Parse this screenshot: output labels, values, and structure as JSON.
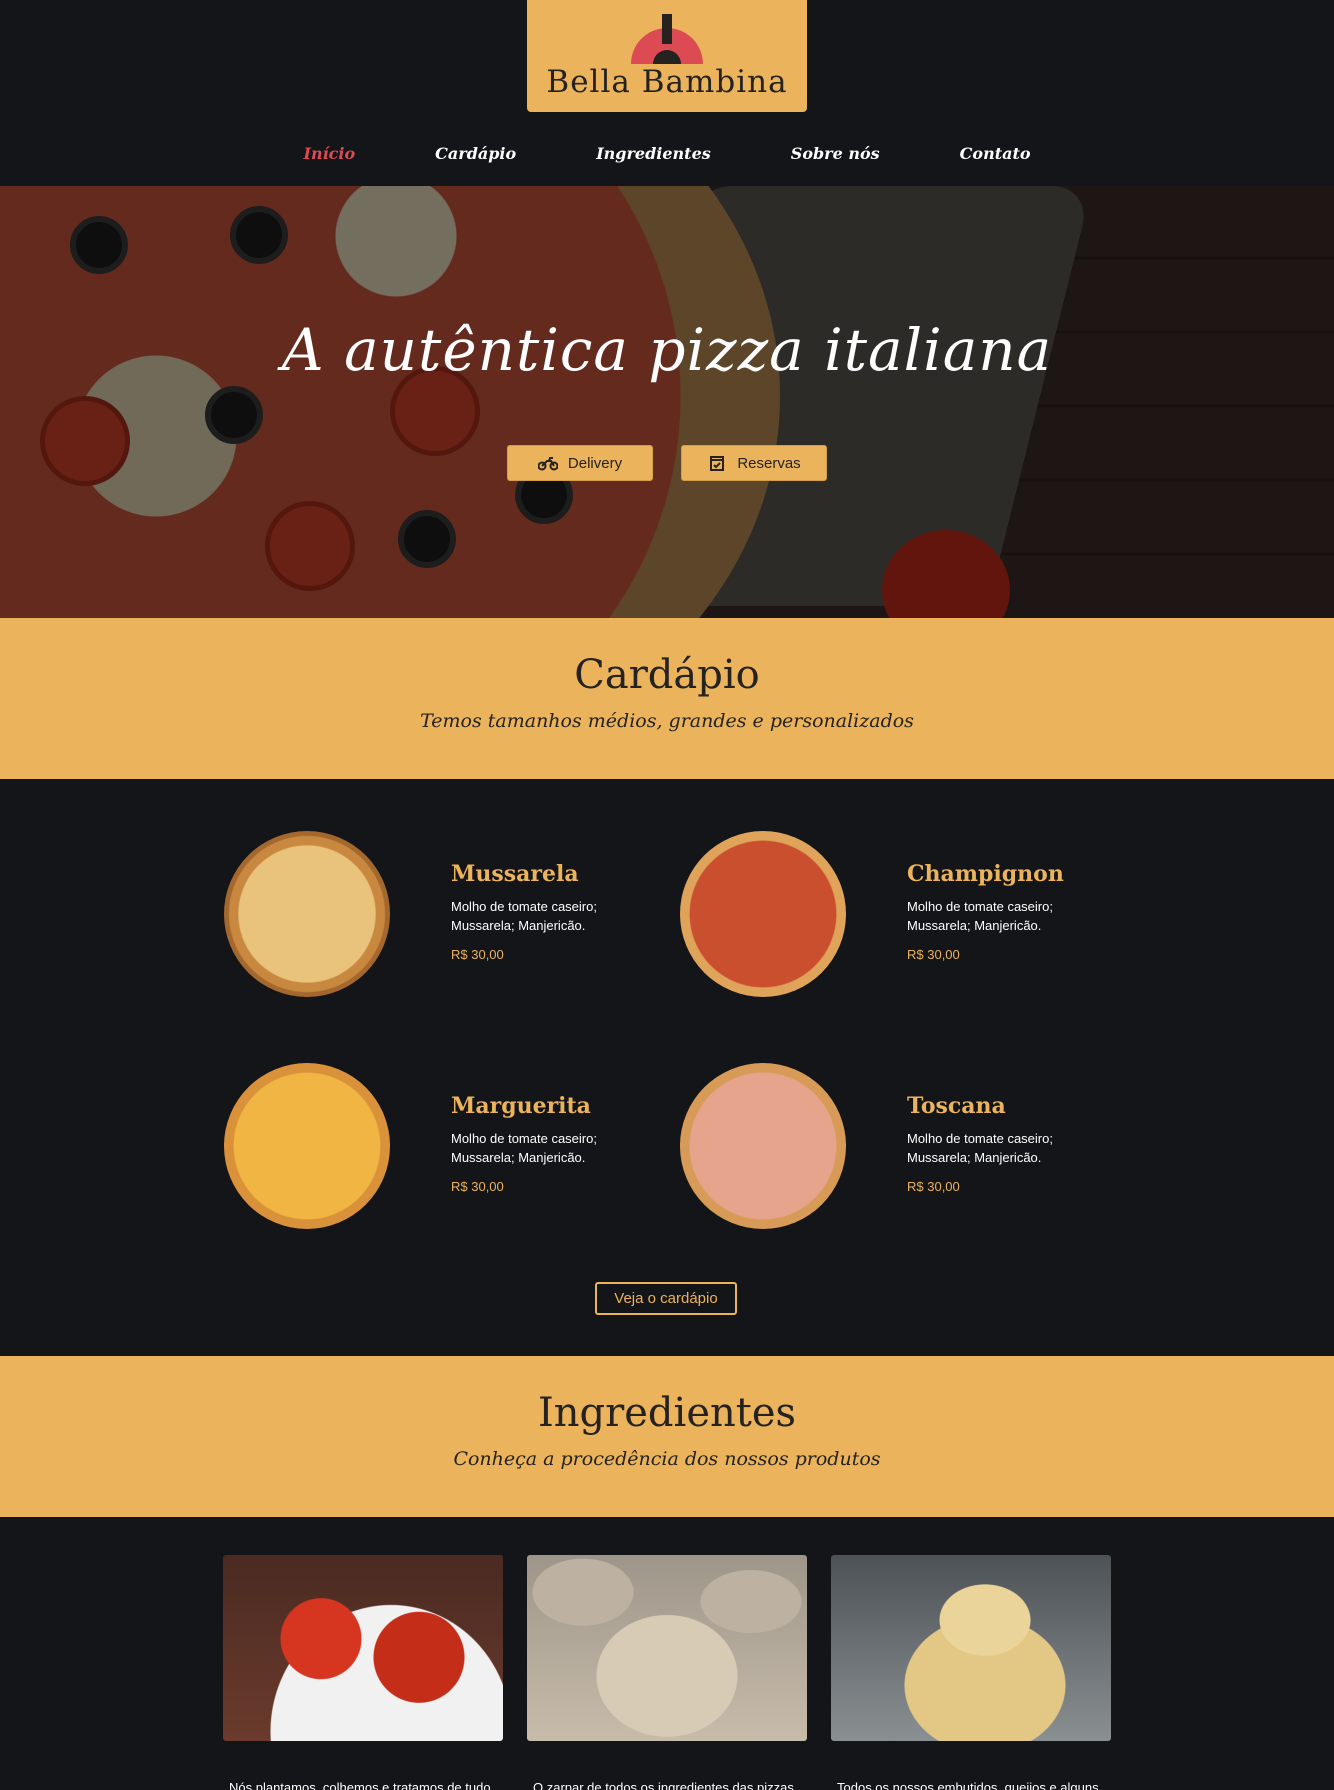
{
  "brand": {
    "name": "Bella Bambina"
  },
  "nav": {
    "items": [
      "Início",
      "Cardápio",
      "Ingredientes",
      "Sobre nós",
      "Contato"
    ]
  },
  "hero": {
    "title": "A autêntica pizza italiana",
    "delivery_label": "Delivery",
    "reservas_label": "Reservas"
  },
  "cardapio": {
    "title": "Cardápio",
    "subtitle": "Temos tamanhos médios, grandes e personalizados",
    "items": [
      {
        "name": "Mussarela",
        "desc1": "Molho de tomate caseiro;",
        "desc2": "Mussarela; Manjericão.",
        "price": "R$ 30,00"
      },
      {
        "name": "Champignon",
        "desc1": "Molho de tomate caseiro;",
        "desc2": "Mussarela; Manjericão.",
        "price": "R$ 30,00"
      },
      {
        "name": "Marguerita",
        "desc1": "Molho de tomate caseiro;",
        "desc2": "Mussarela; Manjericão.",
        "price": "R$ 30,00"
      },
      {
        "name": "Toscana",
        "desc1": "Molho de tomate caseiro;",
        "desc2": "Mussarela; Manjericão.",
        "price": "R$ 30,00"
      }
    ],
    "see_menu_label": "Veja o cardápio"
  },
  "ingredientes": {
    "title": "Ingredientes",
    "subtitle": "Conheça a procedência dos nossos produtos",
    "texts": [
      "Nós plantamos, colhemos e tratamos de tudo",
      "O zarpar de todos os ingredientes das pizzas",
      "Todos os nossos embutidos, queijos e alguns"
    ]
  },
  "colors": {
    "accent": "#ebb35c",
    "active_nav": "#dc4b53",
    "background": "#141518"
  },
  "icons": {
    "delivery": "motorcycle-icon",
    "reservas": "calendar-check-icon"
  }
}
